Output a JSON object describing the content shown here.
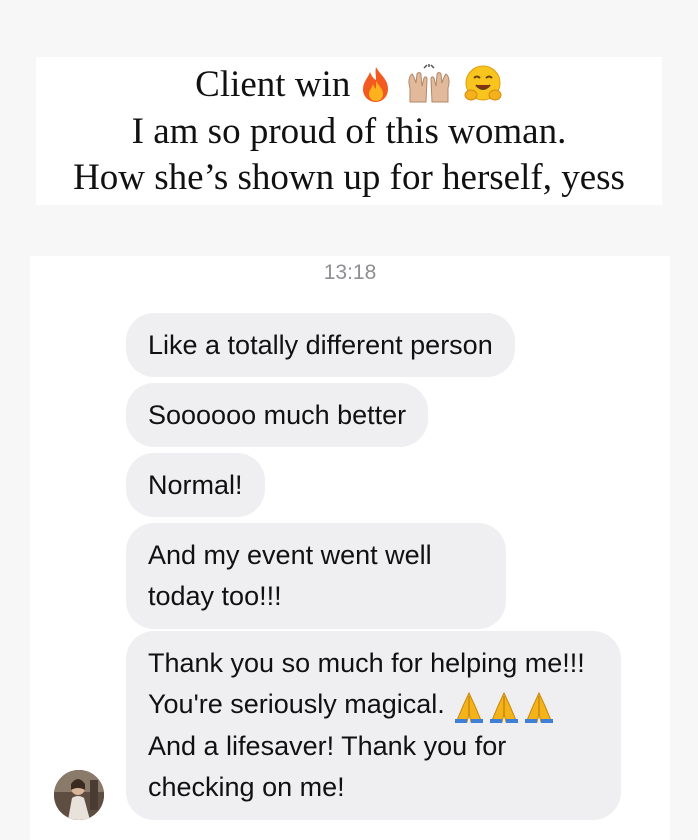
{
  "caption": {
    "line1": "Client win",
    "line2": "I am so proud of this woman.",
    "line3": "How she’s shown up for herself, yess",
    "emojis": [
      "fire-emoji",
      "raised-hands-emoji",
      "hugging-face-emoji"
    ]
  },
  "chat": {
    "timestamp": "13:18",
    "messages": [
      {
        "text": "Like a totally different person"
      },
      {
        "text": "Soooooo much better"
      },
      {
        "text": "Normal!"
      },
      {
        "text": "And my event went well today too!!!"
      },
      {
        "text_before": "Thank you so much for helping me!!! You're seriously magical.",
        "emojis": [
          "folded-hands-emoji",
          "folded-hands-emoji",
          "folded-hands-emoji"
        ],
        "text_after": "And a lifesaver! Thank you for checking on me!"
      }
    ],
    "avatar": "sender-avatar"
  },
  "colors": {
    "page_background": "#f7f7f7",
    "bubble_background": "#efeff1",
    "timestamp_gray": "#8e8e93",
    "text": "#111111"
  }
}
